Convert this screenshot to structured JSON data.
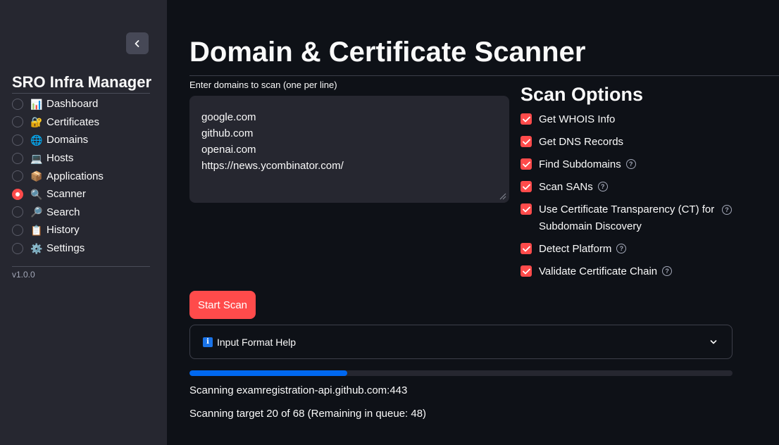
{
  "sidebar": {
    "app_title": "SRO Infra Manager",
    "collapse_icon": "chevron-left-icon",
    "nav_items": [
      {
        "emoji": "📊",
        "icon": "bar-chart-icon",
        "label": "Dashboard",
        "selected": false
      },
      {
        "emoji": "🔐",
        "icon": "lock-key-icon",
        "label": "Certificates",
        "selected": false
      },
      {
        "emoji": "🌐",
        "icon": "globe-icon",
        "label": "Domains",
        "selected": false
      },
      {
        "emoji": "💻",
        "icon": "laptop-icon",
        "label": "Hosts",
        "selected": false
      },
      {
        "emoji": "📦",
        "icon": "package-icon",
        "label": "Applications",
        "selected": false
      },
      {
        "emoji": "🔍",
        "icon": "magnifier-left-icon",
        "label": "Scanner",
        "selected": true
      },
      {
        "emoji": "🔎",
        "icon": "magnifier-right-icon",
        "label": "Search",
        "selected": false
      },
      {
        "emoji": "📋",
        "icon": "clipboard-icon",
        "label": "History",
        "selected": false
      },
      {
        "emoji": "⚙️",
        "icon": "gear-icon",
        "label": "Settings",
        "selected": false
      }
    ],
    "version": "v1.0.0"
  },
  "main": {
    "title": "Domain & Certificate Scanner",
    "domains_input": {
      "label": "Enter domains to scan (one per line)",
      "value": "google.com\ngithub.com\nopenai.com\nhttps://news.ycombinator.com/"
    },
    "scan_options": {
      "heading": "Scan Options",
      "options": [
        {
          "label": "Get WHOIS Info",
          "checked": true,
          "has_help": false
        },
        {
          "label": "Get DNS Records",
          "checked": true,
          "has_help": false
        },
        {
          "label": "Find Subdomains",
          "checked": true,
          "has_help": true
        },
        {
          "label": "Scan SANs",
          "checked": true,
          "has_help": true
        },
        {
          "label": "Use Certificate Transparency (CT) for Subdomain Discovery",
          "checked": true,
          "has_help": true
        },
        {
          "label": "Detect Platform",
          "checked": true,
          "has_help": true
        },
        {
          "label": "Validate Certificate Chain",
          "checked": true,
          "has_help": true
        }
      ]
    },
    "start_button": "Start Scan",
    "help_expander": {
      "icon": "info-icon",
      "label": "Input Format Help",
      "expanded": false
    },
    "progress": {
      "fraction": 0.29
    },
    "status_current": "Scanning examregistration-api.github.com:443",
    "status_queue": "Scanning target 20 of 68 (Remaining in queue: 48)"
  },
  "colors": {
    "background": "#0e1117",
    "sidebar": "#262730",
    "accent": "#ff4b4b",
    "progress": "#0068f0"
  }
}
